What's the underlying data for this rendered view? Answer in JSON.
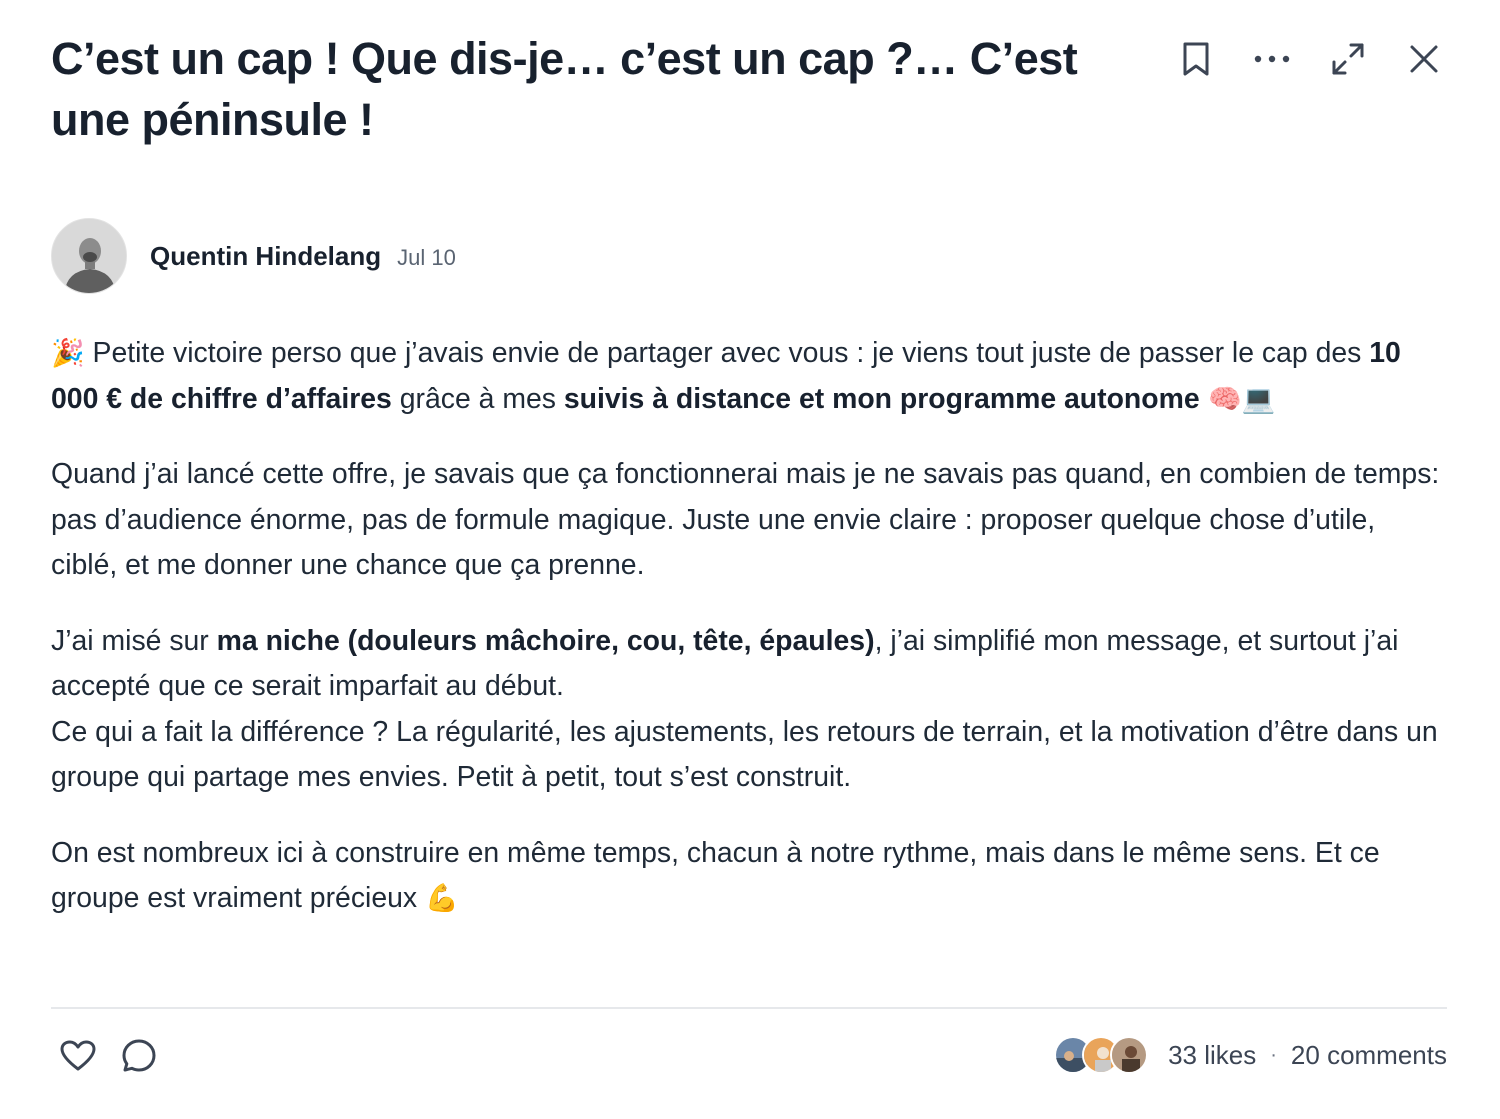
{
  "post": {
    "title": "C’est un cap ! Que dis-je… c’est un cap ?… C’est une péninsule !",
    "author": {
      "name": "Quentin Hindelang",
      "date": "Jul 10"
    },
    "header_icons": [
      "bookmark-icon",
      "more-icon",
      "expand-icon",
      "close-icon"
    ],
    "body": {
      "p1": {
        "emoji": "🎉",
        "t1": " Petite victoire perso que j’avais envie de partager avec vous : je viens tout juste de passer le cap des ",
        "b1": "10 000 € de chiffre d’affaires",
        "t2": " grâce à mes ",
        "b2": "suivis à distance et mon programme autonome",
        "emoji_end": " 🧠💻"
      },
      "p2": "Quand j’ai lancé cette offre, je savais que ça fonctionnerai mais je ne savais pas quand, en combien de temps: pas d’audience énorme, pas de formule magique. Juste une envie claire : proposer quelque chose d’utile, ciblé, et me donner une chance que ça prenne.",
      "p3": {
        "t1": "J’ai misé sur ",
        "b1": "ma niche (douleurs mâchoire, cou, tête, épaules)",
        "t2": ", j’ai simplifié mon message, et surtout j’ai accepté que ce serait imparfait au début.",
        "t3": "Ce qui a fait la différence ? La régularité, les ajustements, les retours de terrain, et la motivation d’être dans un groupe qui partage mes envies. Petit à petit, tout s’est construit."
      },
      "p4": {
        "t1": "On est nombreux ici à construire en même temps, chacun à notre rythme, mais dans le même sens. Et ce groupe est vraiment précieux ",
        "emoji": "💪"
      }
    },
    "footer": {
      "likes": "33 likes",
      "separator": "·",
      "comments": "20 comments",
      "icons": [
        "heart-icon",
        "comment-icon"
      ]
    }
  }
}
